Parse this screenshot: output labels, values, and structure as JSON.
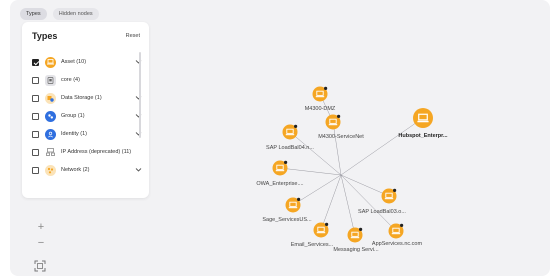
{
  "tabs": [
    {
      "label": "Types",
      "active": true
    },
    {
      "label": "Hidden nodes",
      "active": false
    }
  ],
  "panel": {
    "title": "Types",
    "reset_label": "Reset",
    "items": [
      {
        "label": "Asset (10)",
        "checked": true,
        "expandable": true,
        "icon": "asset-icon",
        "color": "#f5a623"
      },
      {
        "label": "core (4)",
        "checked": false,
        "expandable": false,
        "icon": "core-icon",
        "color": "#d9d9dd"
      },
      {
        "label": "Data Storage (1)",
        "checked": false,
        "expandable": true,
        "icon": "data-storage-icon",
        "color": "#f5a623"
      },
      {
        "label": "Group (1)",
        "checked": false,
        "expandable": true,
        "icon": "group-icon",
        "color": "#2f6fdf"
      },
      {
        "label": "Identity (1)",
        "checked": false,
        "expandable": true,
        "icon": "identity-icon",
        "color": "#2f6fdf"
      },
      {
        "label": "IP Address (deprecated) (11)",
        "checked": false,
        "expandable": false,
        "icon": "ip-address-icon",
        "color": "#d9d9dd"
      },
      {
        "label": "Network (2)",
        "checked": false,
        "expandable": true,
        "icon": "network-icon",
        "color": "#f5a623"
      }
    ]
  },
  "zoom": {
    "in_label": "+",
    "out_label": "−"
  },
  "graph": {
    "node_color": "#f5a623",
    "nodes": [
      {
        "label": "M4300-DMZ",
        "bold": false
      },
      {
        "label": "M4300-ServiceNet",
        "bold": false
      },
      {
        "label": "Hubspot_Enterpr...",
        "bold": true
      },
      {
        "label": "SAP LoadBal04.n...",
        "bold": false
      },
      {
        "label": "OWA_Enterprise....",
        "bold": false
      },
      {
        "label": "Sage_ServicesUS...",
        "bold": false
      },
      {
        "label": "Email_Services...",
        "bold": false
      },
      {
        "label": "Messaging Servi...",
        "bold": false
      },
      {
        "label": "AppServices.nc.com",
        "bold": false
      },
      {
        "label": "SAP LoadBal03.o...",
        "bold": false
      }
    ]
  }
}
